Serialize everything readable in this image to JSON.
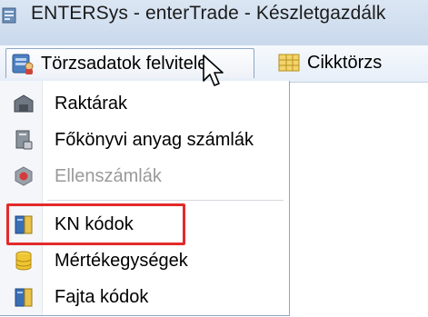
{
  "window": {
    "title": "ENTERSys - enterTrade - Készletgazdálk"
  },
  "menubar": {
    "items": [
      {
        "label": "Törzsadatok felvitele",
        "icon": "database-user-icon",
        "active": true
      },
      {
        "label": "Cikktörzs",
        "icon": "table-grid-icon",
        "active": false
      }
    ]
  },
  "dropdown": {
    "items": [
      {
        "label": "Raktárak",
        "icon": "warehouse-icon",
        "disabled": false
      },
      {
        "label": "Főkönyvi anyag számlák",
        "icon": "ledger-book-icon",
        "disabled": false
      },
      {
        "label": "Ellenszámlák",
        "icon": "red-hexagon-icon",
        "disabled": true
      },
      {
        "label": "KN kódok",
        "icon": "book-binder-icon",
        "disabled": false,
        "highlighted": true
      },
      {
        "label": "Mértékegységek",
        "icon": "database-cylinder-icon",
        "disabled": false
      },
      {
        "label": "Fajta kódok",
        "icon": "book-binder-icon",
        "disabled": false
      }
    ]
  },
  "colors": {
    "highlight_border": "#e32a2a",
    "disabled_text": "#9a9a9a"
  }
}
